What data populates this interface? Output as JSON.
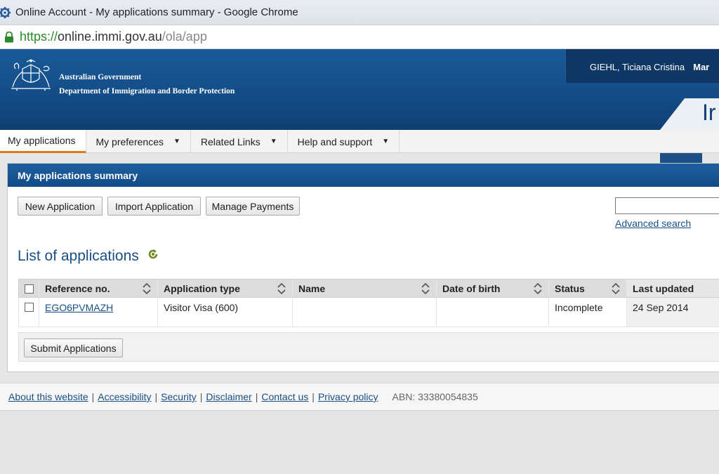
{
  "browser": {
    "window_title": "Online Account - My applications summary - Google Chrome",
    "url_scheme": "https://",
    "url_host": "online.immi.gov.au",
    "url_path": "/ola/app"
  },
  "header": {
    "gov_line1": "Australian Government",
    "gov_line2": "Department of Immigration and Border Protection",
    "user_name": "GIEHL, Ticiana Cristina",
    "user_extra": "Mar",
    "big_tab": "Ir"
  },
  "nav": {
    "items": [
      {
        "label": "My applications"
      },
      {
        "label": "My preferences",
        "caret": "▼"
      },
      {
        "label": "Related Links",
        "caret": "▼"
      },
      {
        "label": "Help and support",
        "caret": "▼"
      }
    ]
  },
  "panel": {
    "title": "My applications summary",
    "buttons": {
      "new": "New Application",
      "import": "Import Application",
      "payments": "Manage Payments"
    },
    "search_value": "",
    "advanced_search": "Advanced search",
    "list_title": "List of applications",
    "submit": "Submit Applications"
  },
  "table": {
    "columns": [
      "Reference no.",
      "Application type",
      "Name",
      "Date of birth",
      "Status",
      "Last updated"
    ],
    "rows": [
      {
        "reference": "EGO6PVMAZH",
        "type": "Visitor Visa (600)",
        "name": "",
        "dob": "",
        "status": "Incomplete",
        "updated": "24 Sep 2014"
      }
    ]
  },
  "footer": {
    "links": [
      "About this website",
      "Accessibility",
      "Security",
      "Disclaimer",
      "Contact us",
      "Privacy policy"
    ],
    "abn": "ABN: 33380054835"
  },
  "colors": {
    "header_blue": "#134c86",
    "accent_orange": "#e07a1f",
    "link_blue": "#1a4f86"
  }
}
